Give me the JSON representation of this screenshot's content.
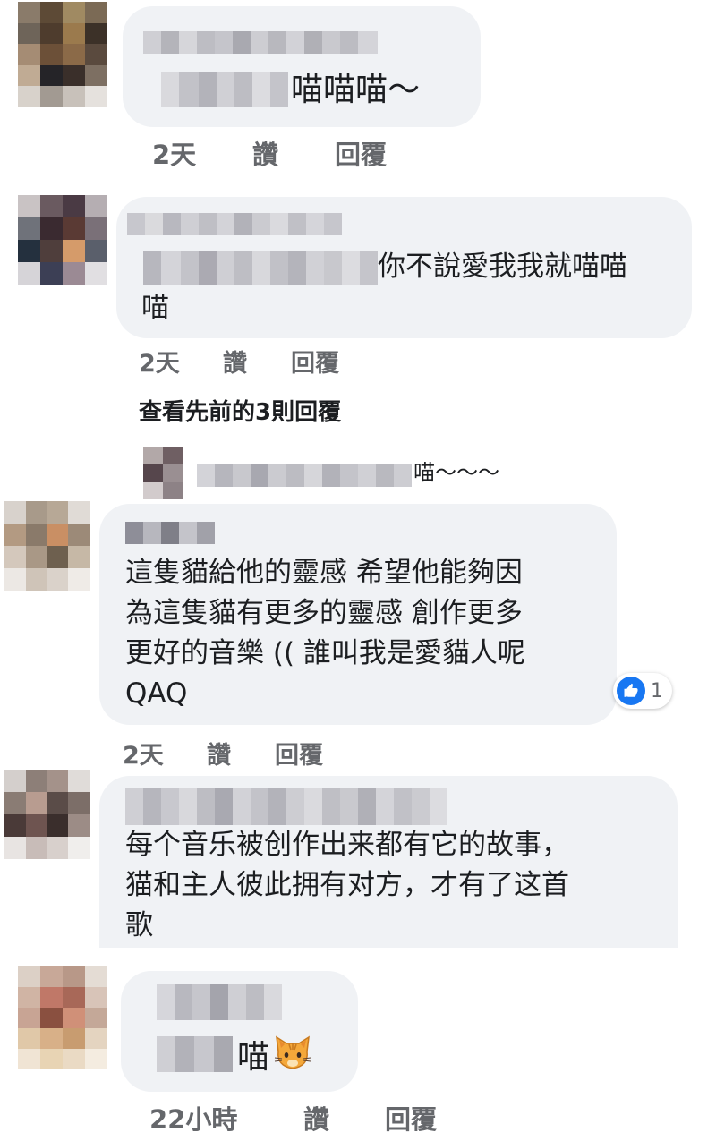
{
  "comments": [
    {
      "text_lines": [
        "喵喵喵～"
      ],
      "meta": {
        "time": "2天",
        "like": "讚",
        "reply": "回覆"
      }
    },
    {
      "text_lines": [
        "你不說愛我我就喵喵",
        "喵"
      ],
      "meta": {
        "time": "2天",
        "like": "讚",
        "reply": "回覆"
      }
    },
    {
      "view_previous": "查看先前的3則回覆",
      "reply_preview": "喵～～～"
    },
    {
      "text_lines": [
        "這隻貓給他的靈感 希望他能夠因",
        "為這隻貓有更多的靈感  創作更多",
        "更好的音樂  (( 誰叫我是愛貓人呢",
        "QAQ"
      ],
      "reaction_count": "1",
      "meta": {
        "time": "2天",
        "like": "讚",
        "reply": "回覆"
      }
    },
    {
      "text_lines": [
        "每个音乐被创作出来都有它的故事，",
        "猫和主人彼此拥有对方，才有了这首",
        "歌"
      ]
    },
    {
      "text_lines": [
        "喵"
      ],
      "emoji": "cat-face-icon",
      "meta": {
        "time": "22小時",
        "like": "讚",
        "reply": "回覆"
      }
    }
  ],
  "colors": {
    "bubble": "#f0f2f5",
    "meta_text": "#65676b",
    "like_blue": "#1877f2"
  }
}
